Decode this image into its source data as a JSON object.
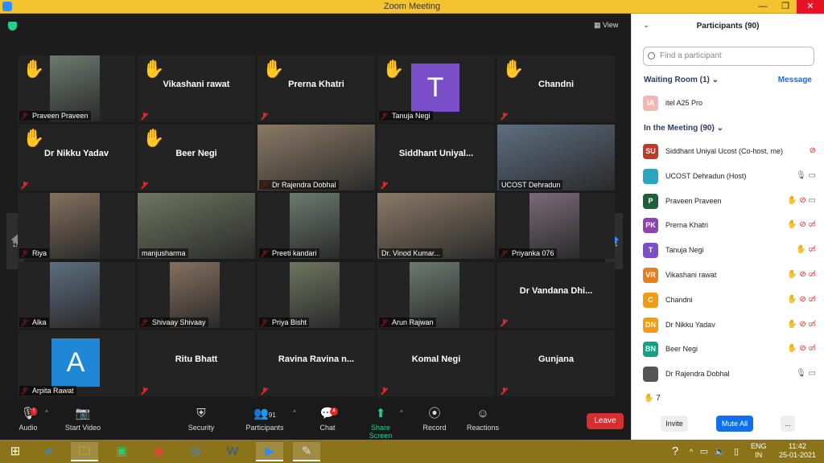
{
  "window": {
    "title": "Zoom Meeting"
  },
  "view_label": "View",
  "tiles": [
    {
      "name": "Praveen Praveen",
      "label": "Praveen Praveen",
      "hand": true,
      "type": "video"
    },
    {
      "name": "Vikashani rawat",
      "hand": true,
      "type": "name"
    },
    {
      "name": "Prerna Khatri",
      "hand": true,
      "type": "name"
    },
    {
      "name": "Tanuja Negi",
      "label": "Tanuja Negi",
      "hand": true,
      "type": "avatar",
      "initial": "T",
      "color": "#7b4fc9"
    },
    {
      "name": "Chandni",
      "hand": true,
      "type": "name"
    },
    {
      "name": "Dr Nikku Yadav",
      "hand": true,
      "type": "name"
    },
    {
      "name": "Beer Negi",
      "hand": true,
      "type": "name"
    },
    {
      "name": "Dr Rajendra Dobhal",
      "label": "Dr Rajendra Dobhal",
      "type": "video",
      "active": true
    },
    {
      "name": "Siddhant Uniyal...",
      "type": "name"
    },
    {
      "name": "UCOST Dehradun",
      "label": "UCOST Dehradun",
      "type": "video",
      "nomic": true
    },
    {
      "name": "Riya",
      "label": "Riya",
      "type": "video"
    },
    {
      "name": "manjusharma",
      "label": "manjusharma",
      "type": "video",
      "nomic": true
    },
    {
      "name": "Preeti kandari",
      "label": "Preeti kandari",
      "type": "video"
    },
    {
      "name": "Dr. Vinod Kumar...",
      "label": "Dr. Vinod Kumar...",
      "type": "video",
      "nomic": true
    },
    {
      "name": "Priyanka 076",
      "label": "Priyanka 076",
      "type": "video"
    },
    {
      "name": "Alka",
      "label": "Alka",
      "type": "video"
    },
    {
      "name": "Shivaay Shivaay",
      "label": "Shivaay Shivaay",
      "type": "video"
    },
    {
      "name": "Priya Bisht",
      "label": "Priya Bisht",
      "type": "video"
    },
    {
      "name": "Arun Rajwan",
      "label": "Arun Rajwan",
      "type": "video"
    },
    {
      "name": "Dr Vandana Dhi...",
      "type": "name"
    },
    {
      "name": "Arpita Rawat",
      "label": "Arpita Rawat",
      "type": "avatar",
      "initial": "A",
      "color": "#1e88d6"
    },
    {
      "name": "Ritu Bhatt",
      "type": "name"
    },
    {
      "name": "Ravina Ravina n...",
      "type": "name"
    },
    {
      "name": "Komal Negi",
      "type": "name"
    },
    {
      "name": "Gunjana",
      "type": "name"
    }
  ],
  "pagination": {
    "left": "1/4",
    "right": "1/4"
  },
  "toolbar": {
    "audio": "Audio",
    "audio_badge": "!",
    "video": "Start Video",
    "security": "Security",
    "participants": "Participants",
    "participants_count": "91",
    "chat": "Chat",
    "chat_badge": "4",
    "share": "Share Screen",
    "record": "Record",
    "reactions": "Reactions",
    "leave": "Leave"
  },
  "panel": {
    "title": "Participants (90)",
    "search_placeholder": "Find a participant",
    "waiting_room": "Waiting Room (1)",
    "message": "Message",
    "in_meeting": "In the Meeting (90)",
    "hand_count": "7",
    "invite": "Invite",
    "mute_all": "Mute All",
    "more": "...",
    "waiting": [
      {
        "initials": "IA",
        "name": "itel A25 Pro",
        "color": "#f0b8b0"
      }
    ],
    "participants": [
      {
        "initials": "SU",
        "name": "Siddhant Uniyal Ucost (Co-host, me)",
        "color": "#c0392b",
        "hand": false,
        "mic": "muted",
        "cam": "none"
      },
      {
        "initials": "",
        "name": "UCOST Dehradun (Host)",
        "color": "#2aa5c0",
        "hand": false,
        "mic": "on",
        "cam": "on"
      },
      {
        "initials": "P",
        "name": "Praveen Praveen",
        "color": "#1e5e3b",
        "hand": true,
        "mic": "muted",
        "cam": "on"
      },
      {
        "initials": "PK",
        "name": "Prerna Khatri",
        "color": "#8e44ad",
        "hand": true,
        "mic": "muted",
        "cam": "off"
      },
      {
        "initials": "T",
        "name": "Tanuja Negi",
        "color": "#7b4fc9",
        "hand": true,
        "mic": "none",
        "cam": "off"
      },
      {
        "initials": "VR",
        "name": "Vikashani rawat",
        "color": "#e67e22",
        "hand": true,
        "mic": "muted",
        "cam": "off"
      },
      {
        "initials": "C",
        "name": "Chandni",
        "color": "#f39c12",
        "hand": true,
        "mic": "muted",
        "cam": "off"
      },
      {
        "initials": "DN",
        "name": "Dr Nikku Yadav",
        "color": "#f39c12",
        "hand": true,
        "mic": "muted",
        "cam": "off"
      },
      {
        "initials": "BN",
        "name": "Beer Negi",
        "color": "#16a085",
        "hand": true,
        "mic": "muted",
        "cam": "off"
      },
      {
        "initials": "",
        "name": "Dr Rajendra Dobhal",
        "color": "#555555",
        "hand": false,
        "mic": "on",
        "cam": "on"
      }
    ]
  },
  "taskbar": {
    "lang1": "ENG",
    "lang2": "IN",
    "time": "11:42",
    "date": "25-01-2021"
  }
}
